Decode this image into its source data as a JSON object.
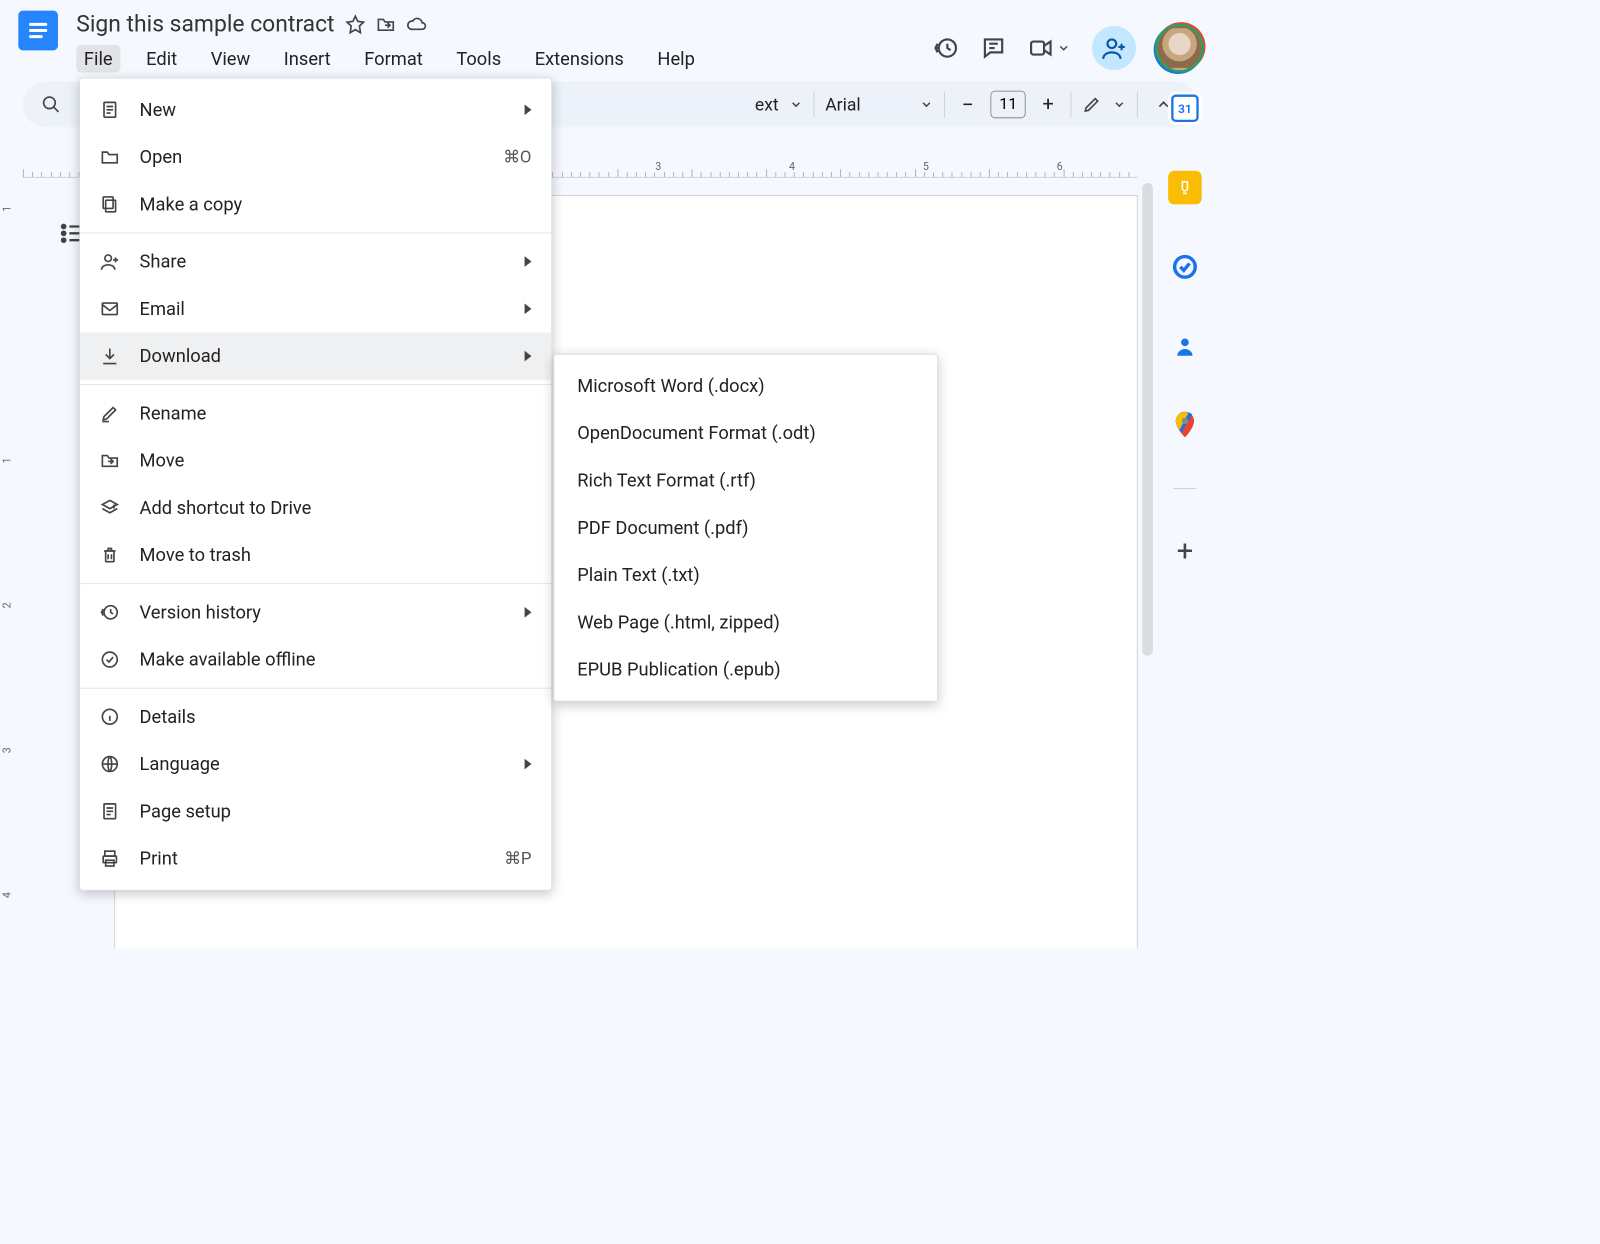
{
  "doc_title": "Sign this sample contract",
  "menubar": [
    "File",
    "Edit",
    "View",
    "Insert",
    "Format",
    "Tools",
    "Extensions",
    "Help"
  ],
  "active_menu_index": 0,
  "toolbar": {
    "styles_text": "ext",
    "font_name": "Arial",
    "font_size": "11"
  },
  "file_menu": {
    "sections": [
      [
        {
          "icon": "page",
          "label": "New",
          "sub": true
        },
        {
          "icon": "folder",
          "label": "Open",
          "shortcut": "⌘O"
        },
        {
          "icon": "copy",
          "label": "Make a copy"
        }
      ],
      [
        {
          "icon": "person-add",
          "label": "Share",
          "sub": true
        },
        {
          "icon": "mail",
          "label": "Email",
          "sub": true
        },
        {
          "icon": "download",
          "label": "Download",
          "sub": true,
          "hover": true
        }
      ],
      [
        {
          "icon": "rename",
          "label": "Rename"
        },
        {
          "icon": "move",
          "label": "Move"
        },
        {
          "icon": "shortcut",
          "label": "Add shortcut to Drive"
        },
        {
          "icon": "trash",
          "label": "Move to trash"
        }
      ],
      [
        {
          "icon": "history",
          "label": "Version history",
          "sub": true
        },
        {
          "icon": "offline",
          "label": "Make available offline"
        }
      ],
      [
        {
          "icon": "info",
          "label": "Details"
        },
        {
          "icon": "globe",
          "label": "Language",
          "sub": true
        },
        {
          "icon": "page",
          "label": "Page setup"
        },
        {
          "icon": "print",
          "label": "Print",
          "shortcut": "⌘P"
        }
      ]
    ]
  },
  "download_submenu": [
    "Microsoft Word (.docx)",
    "OpenDocument Format (.odt)",
    "Rich Text Format (.rtf)",
    "PDF Document (.pdf)",
    "Plain Text (.txt)",
    "Web Page (.html, zipped)",
    "EPUB Publication (.epub)"
  ],
  "ruler_h_numbers": [
    3,
    4,
    5,
    6
  ],
  "ruler_v_numbers": [
    1,
    1,
    2,
    3,
    4
  ],
  "side_items": [
    "calendar",
    "keep",
    "tasks",
    "contacts",
    "maps"
  ]
}
